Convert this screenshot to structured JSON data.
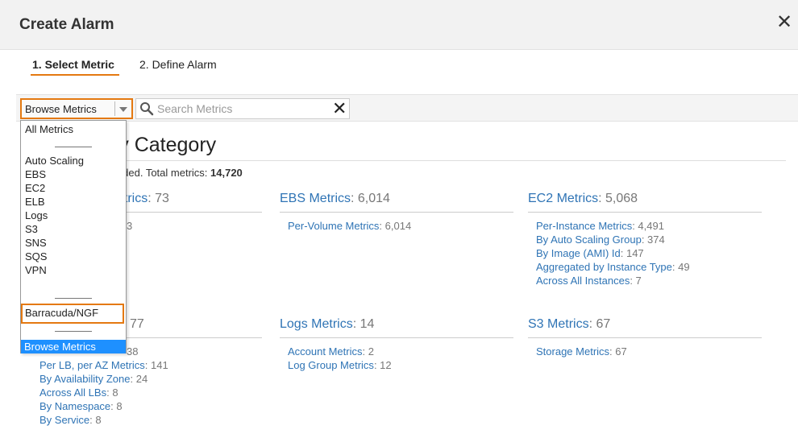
{
  "dialog": {
    "title": "Create Alarm"
  },
  "steps": [
    {
      "label": "1. Select Metric"
    },
    {
      "label": "2. Define Alarm"
    }
  ],
  "toolbar": {
    "browse_label": "Browse Metrics",
    "search_placeholder": "Search Metrics"
  },
  "heading": "h Metrics by Category",
  "summary": {
    "text": "etric summary has loaded. Total metrics: ",
    "total": "14,720"
  },
  "categories": [
    {
      "title": "etrics",
      "count": ": 73",
      "links": [
        {
          "label": "",
          "count": "3"
        }
      ]
    },
    {
      "title": "EBS Metrics",
      "count": ": 6,014",
      "links": [
        {
          "label": "Per-Volume Metrics",
          "count": ": 6,014"
        }
      ]
    },
    {
      "title": "EC2 Metrics",
      "count": ": 5,068",
      "links": [
        {
          "label": "Per-Instance Metrics",
          "count": ": 4,491"
        },
        {
          "label": "By Auto Scaling Group",
          "count": ": 374"
        },
        {
          "label": "By Image (AMI) Id",
          "count": ": 147"
        },
        {
          "label": "Aggregated by Instance Type",
          "count": ": 49"
        },
        {
          "label": "Across All Instances",
          "count": ": 7"
        }
      ]
    },
    {
      "title": "",
      "count": "77",
      "links": [
        {
          "label": "",
          "count": "38"
        },
        {
          "label": "Per LB, per AZ Metrics",
          "count": ": 141"
        },
        {
          "label": "By Availability Zone",
          "count": ": 24"
        },
        {
          "label": "Across All LBs",
          "count": ": 8"
        },
        {
          "label": "By Namespace",
          "count": ": 8"
        },
        {
          "label": "By Service",
          "count": ": 8"
        }
      ]
    },
    {
      "title": "Logs Metrics",
      "count": ": 14",
      "links": [
        {
          "label": "Account Metrics",
          "count": ": 2"
        },
        {
          "label": "Log Group Metrics",
          "count": ": 12"
        }
      ]
    },
    {
      "title": "S3 Metrics",
      "count": ": 67",
      "links": [
        {
          "label": "Storage Metrics",
          "count": ": 67"
        }
      ]
    }
  ],
  "dropdown": {
    "items": [
      "All Metrics",
      "Auto Scaling",
      "EBS",
      "EC2",
      "ELB",
      "Logs",
      "S3",
      "SNS",
      "SQS",
      "VPN"
    ],
    "barracuda": "Barracuda/NGF",
    "selected": "Browse Metrics"
  },
  "colors": {
    "accent": "#e47911",
    "link": "#2f74b5",
    "selected": "#1e90ff"
  },
  "icons": {
    "close": "close-icon",
    "search": "search-icon",
    "dropdown": "chevron-down-icon"
  }
}
